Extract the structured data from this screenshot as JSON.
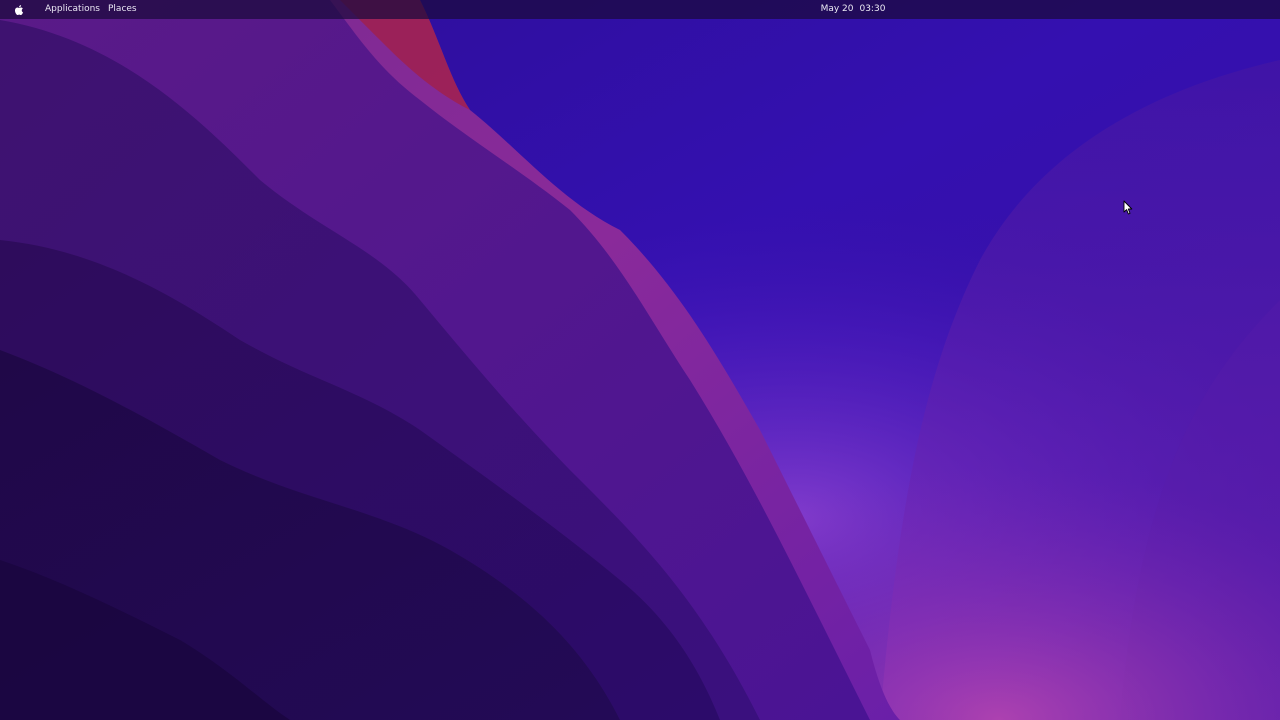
{
  "topbar": {
    "apple_icon": "apple-icon",
    "menus": [
      {
        "label": "Applications"
      },
      {
        "label": "Places"
      }
    ],
    "clock": {
      "date": "May 20",
      "time": "03:30"
    }
  },
  "desktop": {
    "wallpaper": "purple-dunes",
    "cursor_icon": "arrow-cursor-icon",
    "colors": {
      "deep_violet": "#1e0a4e",
      "violet": "#3510a8",
      "magenta": "#9b2a8c",
      "crimson_ridge": "#a0204f"
    }
  }
}
